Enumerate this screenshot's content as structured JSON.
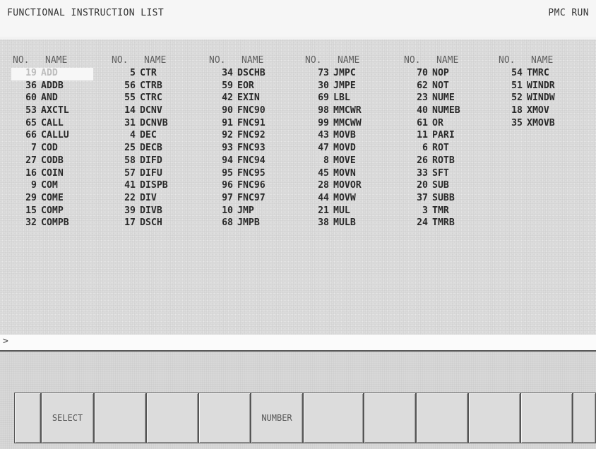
{
  "header": {
    "title": "FUNCTIONAL INSTRUCTION LIST",
    "status": "PMC RUN"
  },
  "columns": [
    {
      "no_label": "NO.",
      "name_label": "NAME",
      "entries": [
        {
          "no": "19",
          "name": "ADD"
        },
        {
          "no": "36",
          "name": "ADDB"
        },
        {
          "no": "60",
          "name": "AND"
        },
        {
          "no": "53",
          "name": "AXCTL"
        },
        {
          "no": "65",
          "name": "CALL"
        },
        {
          "no": "66",
          "name": "CALLU"
        },
        {
          "no": "7",
          "name": "COD"
        },
        {
          "no": "27",
          "name": "CODB"
        },
        {
          "no": "16",
          "name": "COIN"
        },
        {
          "no": "9",
          "name": "COM"
        },
        {
          "no": "29",
          "name": "COME"
        },
        {
          "no": "15",
          "name": "COMP"
        },
        {
          "no": "32",
          "name": "COMPB"
        }
      ]
    },
    {
      "no_label": "NO.",
      "name_label": "NAME",
      "entries": [
        {
          "no": "5",
          "name": "CTR"
        },
        {
          "no": "56",
          "name": "CTRB"
        },
        {
          "no": "55",
          "name": "CTRC"
        },
        {
          "no": "14",
          "name": "DCNV"
        },
        {
          "no": "31",
          "name": "DCNVB"
        },
        {
          "no": "4",
          "name": "DEC"
        },
        {
          "no": "25",
          "name": "DECB"
        },
        {
          "no": "58",
          "name": "DIFD"
        },
        {
          "no": "57",
          "name": "DIFU"
        },
        {
          "no": "41",
          "name": "DISPB"
        },
        {
          "no": "22",
          "name": "DIV"
        },
        {
          "no": "39",
          "name": "DIVB"
        },
        {
          "no": "17",
          "name": "DSCH"
        }
      ]
    },
    {
      "no_label": "NO.",
      "name_label": "NAME",
      "entries": [
        {
          "no": "34",
          "name": "DSCHB"
        },
        {
          "no": "59",
          "name": "EOR"
        },
        {
          "no": "42",
          "name": "EXIN"
        },
        {
          "no": "90",
          "name": "FNC90"
        },
        {
          "no": "91",
          "name": "FNC91"
        },
        {
          "no": "92",
          "name": "FNC92"
        },
        {
          "no": "93",
          "name": "FNC93"
        },
        {
          "no": "94",
          "name": "FNC94"
        },
        {
          "no": "95",
          "name": "FNC95"
        },
        {
          "no": "96",
          "name": "FNC96"
        },
        {
          "no": "97",
          "name": "FNC97"
        },
        {
          "no": "10",
          "name": "JMP"
        },
        {
          "no": "68",
          "name": "JMPB"
        }
      ]
    },
    {
      "no_label": "NO.",
      "name_label": "NAME",
      "entries": [
        {
          "no": "73",
          "name": "JMPC"
        },
        {
          "no": "30",
          "name": "JMPE"
        },
        {
          "no": "69",
          "name": "LBL"
        },
        {
          "no": "98",
          "name": "MMCWR"
        },
        {
          "no": "99",
          "name": "MMCWW"
        },
        {
          "no": "43",
          "name": "MOVB"
        },
        {
          "no": "47",
          "name": "MOVD"
        },
        {
          "no": "8",
          "name": "MOVE"
        },
        {
          "no": "45",
          "name": "MOVN"
        },
        {
          "no": "28",
          "name": "MOVOR"
        },
        {
          "no": "44",
          "name": "MOVW"
        },
        {
          "no": "21",
          "name": "MUL"
        },
        {
          "no": "38",
          "name": "MULB"
        }
      ]
    },
    {
      "no_label": "NO.",
      "name_label": "NAME",
      "entries": [
        {
          "no": "70",
          "name": "NOP"
        },
        {
          "no": "62",
          "name": "NOT"
        },
        {
          "no": "23",
          "name": "NUME"
        },
        {
          "no": "40",
          "name": "NUMEB"
        },
        {
          "no": "61",
          "name": "OR"
        },
        {
          "no": "11",
          "name": "PARI"
        },
        {
          "no": "6",
          "name": "ROT"
        },
        {
          "no": "26",
          "name": "ROTB"
        },
        {
          "no": "33",
          "name": "SFT"
        },
        {
          "no": "20",
          "name": "SUB"
        },
        {
          "no": "37",
          "name": "SUBB"
        },
        {
          "no": "3",
          "name": "TMR"
        },
        {
          "no": "24",
          "name": "TMRB"
        }
      ]
    },
    {
      "no_label": "NO.",
      "name_label": "NAME",
      "entries": [
        {
          "no": "54",
          "name": "TMRC"
        },
        {
          "no": "51",
          "name": "WINDR"
        },
        {
          "no": "52",
          "name": "WINDW"
        },
        {
          "no": "18",
          "name": "XMOV"
        },
        {
          "no": "35",
          "name": "XMOVB"
        }
      ]
    }
  ],
  "input_line": {
    "prompt": ">"
  },
  "softkeys": [
    "",
    "SELECT",
    "",
    "",
    "",
    "NUMBER",
    "",
    "",
    "",
    "",
    "",
    ""
  ]
}
